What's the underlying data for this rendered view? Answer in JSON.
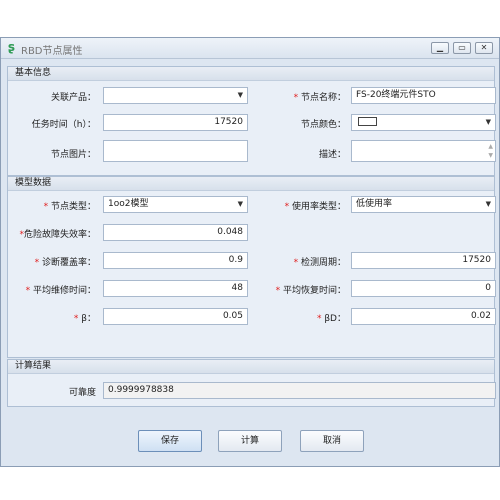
{
  "window": {
    "title": "RBD节点属性"
  },
  "basic": {
    "header": "基本信息",
    "product_label": "关联产品：",
    "product_value": "",
    "node_name_label": "节点名称：",
    "node_name_value": "FS-20终端元件STO",
    "mission_time_label": "任务时间（h）：",
    "mission_time_value": "17520",
    "node_color_label": "节点颜色：",
    "node_color_value": "#ffffff",
    "node_image_label": "节点图片：",
    "node_image_value": "",
    "desc_label": "描述：",
    "desc_value": ""
  },
  "model": {
    "header": "模型数据",
    "node_type_label": "节点类型：",
    "node_type_value": "1oo2模型",
    "usage_type_label": "使用率类型：",
    "usage_type_value": "低使用率",
    "dangerous_failure_label": "危险故障失效率：",
    "dangerous_failure_value": "0.048",
    "diag_coverage_label": "诊断覆盖率：",
    "diag_coverage_value": "0.9",
    "test_period_label": "检测周期：",
    "test_period_value": "17520",
    "mttr_label": "平均维修时间：",
    "mttr_value": "48",
    "mrt_label": "平均恢复时间：",
    "mrt_value": "0",
    "beta_label": "β：",
    "beta_value": "0.05",
    "beta_d_label": "βD：",
    "beta_d_value": "0.02"
  },
  "result": {
    "header": "计算结果",
    "reliability_label": "可靠度",
    "reliability_value": "0.9999978838"
  },
  "buttons": {
    "save": "保存",
    "calc": "计算",
    "cancel": "取消"
  },
  "required_mark": "*"
}
